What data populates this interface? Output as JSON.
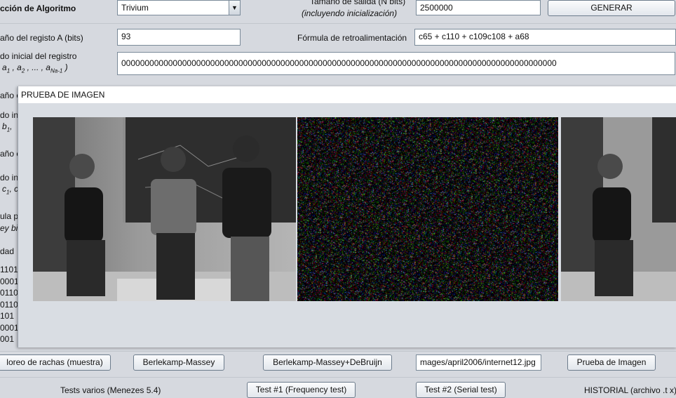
{
  "form": {
    "algorithm_label": "cción de Algoritmo",
    "algorithm_value": "Trivium",
    "output_size_label_line1": "Tamaño de salida (N bits)",
    "output_size_label_line2": "(incluyendo inicialización)",
    "output_size_value": "2500000",
    "generate_button": "GENERAR",
    "reg_a_size_label": "año del registo A (bits)",
    "reg_a_size_value": "93",
    "feedback_label": "Fórmula de retroalimentación",
    "feedback_value": "c65 + c110 + c109c108 + a68",
    "initial_state_label_line1": "do inicial del registro",
    "initial_state_label_line2": "a",
    "initial_state_value": "000000000000000000000000000000000000000000000000000000000000000000000000000000000000000000000",
    "left_fragments": [
      "año c",
      "do ini",
      "b",
      "año c",
      "do ini",
      "c",
      "ula p",
      "ey bi",
      "dad"
    ],
    "bit_rows": [
      "1101",
      "0001",
      "0110",
      "0110",
      "101",
      "0001",
      "001"
    ]
  },
  "dialog": {
    "title": "PRUEBA DE IMAGEN"
  },
  "bottom": {
    "runs_button": "loreo de rachas (muestra)",
    "berlekamp_button": "Berlekamp-Massey",
    "berlekamp_debruijn_button": "Berlekamp-Massey+DeBruijn",
    "image_path_value": "mages/april2006/internet12.jpg",
    "image_test_button": "Prueba de Imagen",
    "tests_label": "Tests varios (Menezes 5.4)",
    "test1_button": "Test #1 (Frequency test)",
    "test2_button": "Test #2 (Serial test)",
    "history_label": "HISTORIAL (archivo .t x)"
  },
  "colors": {
    "background": "#d6d9df",
    "dialog_bg": "#d9dde3",
    "field_border": "#7a8a99"
  }
}
